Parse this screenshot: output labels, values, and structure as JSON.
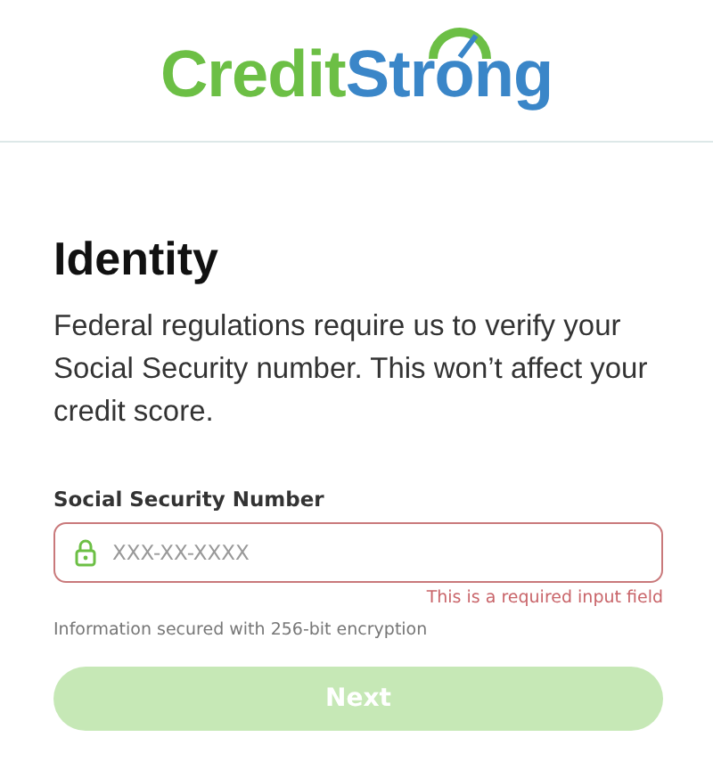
{
  "logo": {
    "parts": [
      "Credit",
      "Strong"
    ]
  },
  "heading": "Identity",
  "description": "Federal regulations require us to verify your Social Security number. This won’t affect your credit score.",
  "field": {
    "label": "Social Security Number",
    "placeholder": "XXX-XX-XXXX",
    "invalid": true,
    "error": "This is a required input field"
  },
  "note": "Information secured with 256-bit encryption",
  "button": {
    "label": "Next",
    "disabled": true
  }
}
